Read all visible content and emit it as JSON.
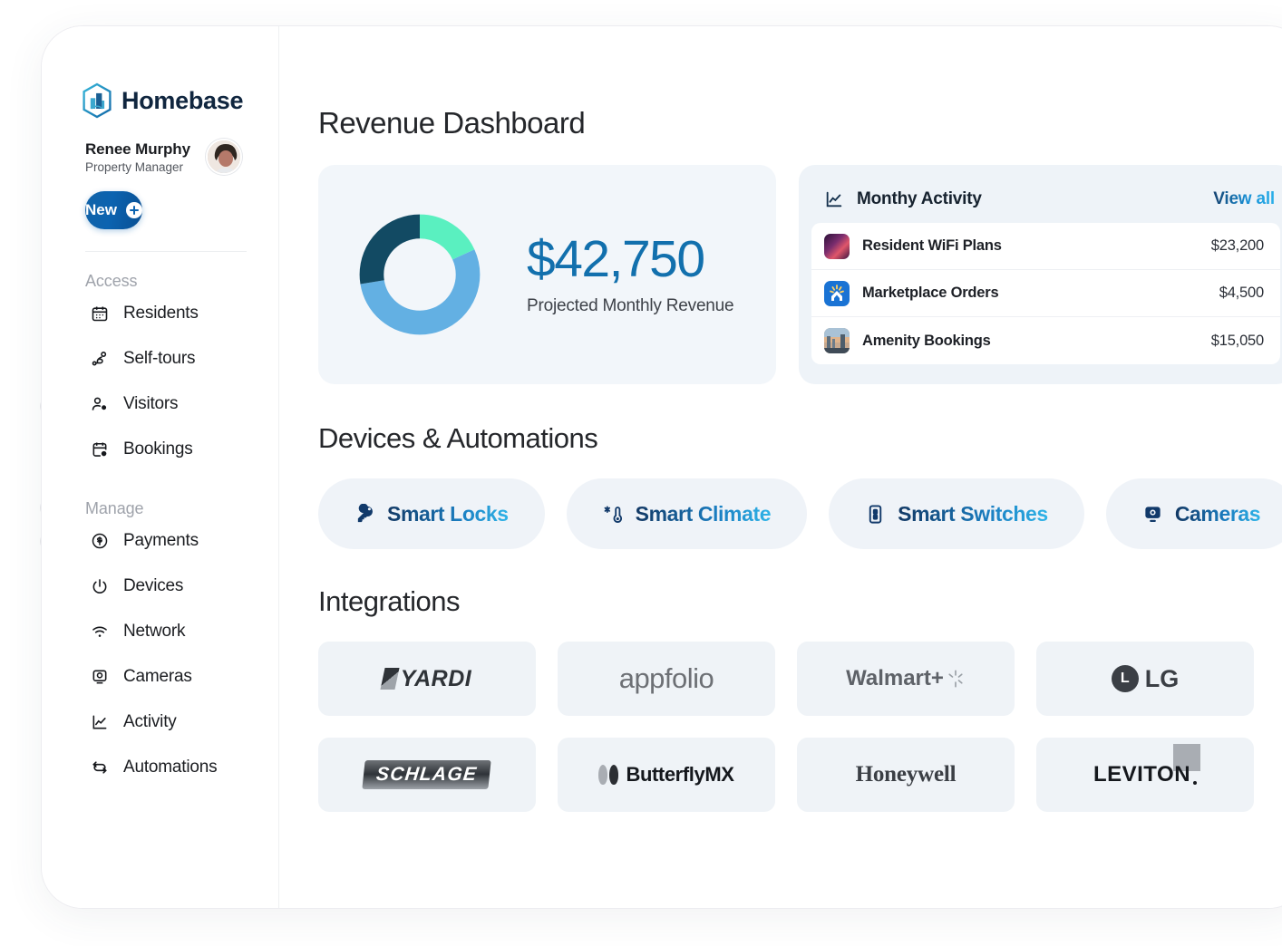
{
  "brand": {
    "name": "Homebase",
    "logo_icon": "homebase-hexagon-logo"
  },
  "user": {
    "name": "Renee Murphy",
    "role": "Property Manager",
    "avatar": "user-avatar"
  },
  "new_button": {
    "label": "New",
    "icon": "plus-circle-icon"
  },
  "sidebar": {
    "sections": [
      {
        "title": "Access",
        "items": [
          {
            "label": "Residents",
            "icon": "calendar-grid-icon"
          },
          {
            "label": "Self-tours",
            "icon": "route-path-icon"
          },
          {
            "label": "Visitors",
            "icon": "user-check-icon"
          },
          {
            "label": "Bookings",
            "icon": "calendar-clock-icon"
          }
        ]
      },
      {
        "title": "Manage",
        "items": [
          {
            "label": "Payments",
            "icon": "dollar-circle-icon"
          },
          {
            "label": "Devices",
            "icon": "power-icon"
          },
          {
            "label": "Network",
            "icon": "wifi-icon"
          },
          {
            "label": "Cameras",
            "icon": "camera-icon"
          },
          {
            "label": "Activity",
            "icon": "line-chart-icon"
          },
          {
            "label": "Automations",
            "icon": "refresh-cycle-icon"
          }
        ]
      }
    ]
  },
  "main": {
    "page_title": "Revenue Dashboard",
    "revenue_card": {
      "amount": "$42,750",
      "caption": "Projected Monthly Revenue"
    },
    "activity_card": {
      "title": "Monthy Activity",
      "title_icon": "line-chart-icon",
      "view_all_label": "View all",
      "rows": [
        {
          "name": "Resident WiFi Plans",
          "value": "$23,200",
          "icon": "wifi-app-icon"
        },
        {
          "name": "Marketplace Orders",
          "value": "$4,500",
          "icon": "marketplace-app-icon"
        },
        {
          "name": "Amenity Bookings",
          "value": "$15,050",
          "icon": "amenity-photo-icon"
        }
      ]
    },
    "devices_section": {
      "title": "Devices & Automations",
      "pills": [
        {
          "label": "Smart Locks",
          "icon": "key-icon"
        },
        {
          "label": "Smart Climate",
          "icon": "thermometer-snowflake-icon"
        },
        {
          "label": "Smart Switches",
          "icon": "switch-icon"
        },
        {
          "label": "Cameras",
          "icon": "camera-icon"
        }
      ]
    },
    "integrations_section": {
      "title": "Integrations",
      "logos": [
        {
          "name": "YARDI"
        },
        {
          "name": "appfolio"
        },
        {
          "name": "Walmart+"
        },
        {
          "name": "LG"
        },
        {
          "name": "SCHLAGE"
        },
        {
          "name": "ButterflyMX"
        },
        {
          "name": "Honeywell"
        },
        {
          "name": "LEVITON"
        }
      ]
    }
  },
  "chart_data": {
    "type": "pie",
    "title": "Projected Monthly Revenue",
    "total": 42750,
    "categories": [
      "Resident WiFi Plans",
      "Amenity Bookings",
      "Marketplace Orders"
    ],
    "values": [
      23200,
      15050,
      4500
    ],
    "colors": [
      "#63b0e3",
      "#124a63",
      "#5af0c0"
    ],
    "legend": "none",
    "grid": false
  },
  "colors": {
    "accent_blue": "#1270ad",
    "brand_navy": "#10263f",
    "link_gradient_start": "#14406e",
    "link_gradient_end": "#2ab0ea",
    "card_bg": "#eff3f8",
    "revenue_card_bg": "#f2f6fa"
  }
}
